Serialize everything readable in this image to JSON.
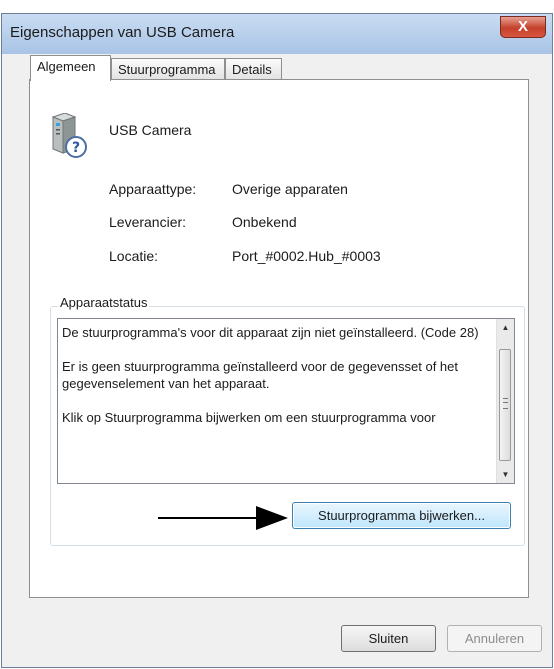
{
  "window": {
    "title": "Eigenschappen van USB Camera",
    "close_glyph": "X"
  },
  "tabs": [
    {
      "label": "Algemeen",
      "active": true
    },
    {
      "label": "Stuurprogramma",
      "active": false
    },
    {
      "label": "Details",
      "active": false
    }
  ],
  "device": {
    "name": "USB Camera",
    "icon": "usb-device-question-icon",
    "properties": [
      {
        "label": "Apparaattype:",
        "value": "Overige apparaten"
      },
      {
        "label": "Leverancier:",
        "value": "Onbekend"
      },
      {
        "label": "Locatie:",
        "value": "Port_#0002.Hub_#0003"
      }
    ]
  },
  "status": {
    "group_label": "Apparaatstatus",
    "paragraphs": [
      "De stuurprogramma's voor dit apparaat zijn niet geïnstalleerd. (Code 28)",
      "Er is geen stuurprogramma geïnstalleerd voor de gegevensset of het gegevenselement van het apparaat.",
      "Klik op Stuurprogramma bijwerken om een stuurprogramma voor"
    ],
    "update_button": "Stuurprogramma bijwerken..."
  },
  "footer": {
    "close_button": "Sluiten",
    "cancel_button": "Annuleren"
  },
  "colors": {
    "close_button": "#c4412c",
    "focus_border": "#3c7fb1"
  }
}
